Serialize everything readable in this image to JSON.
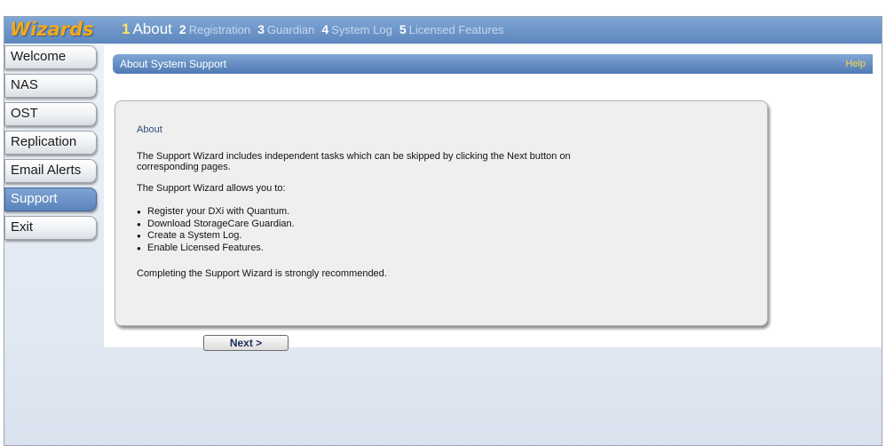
{
  "brand": {
    "name": "Wizards"
  },
  "steps": [
    {
      "num": "1",
      "label": "About",
      "active": true
    },
    {
      "num": "2",
      "label": "Registration",
      "active": false
    },
    {
      "num": "3",
      "label": "Guardian",
      "active": false
    },
    {
      "num": "4",
      "label": "System Log",
      "active": false
    },
    {
      "num": "5",
      "label": "Licensed Features",
      "active": false
    }
  ],
  "sidebar": {
    "items": [
      {
        "label": "Welcome"
      },
      {
        "label": "NAS"
      },
      {
        "label": "OST"
      },
      {
        "label": "Replication"
      },
      {
        "label": "Email Alerts"
      },
      {
        "label": "Support",
        "active": true
      },
      {
        "label": "Exit"
      }
    ]
  },
  "section": {
    "title": "About System Support",
    "help": "Help"
  },
  "panel": {
    "title": "About",
    "para1": "The Support Wizard includes independent tasks which can be skipped by clicking the Next button on corresponding pages.",
    "para2": "The Support Wizard allows you to:",
    "bullets": [
      "Register your DXi with Quantum.",
      "Download StorageCare Guardian.",
      "Create a System Log.",
      "Enable Licensed Features."
    ],
    "footer": "Completing the Support Wizard is strongly recommended."
  },
  "actions": {
    "next_label": "Next >"
  },
  "colors": {
    "header_blue": "#5d86bd",
    "brand_orange": "#f2a91a",
    "help_yellow": "#f7d94a",
    "active_nav_blue": "#5b84bd"
  }
}
